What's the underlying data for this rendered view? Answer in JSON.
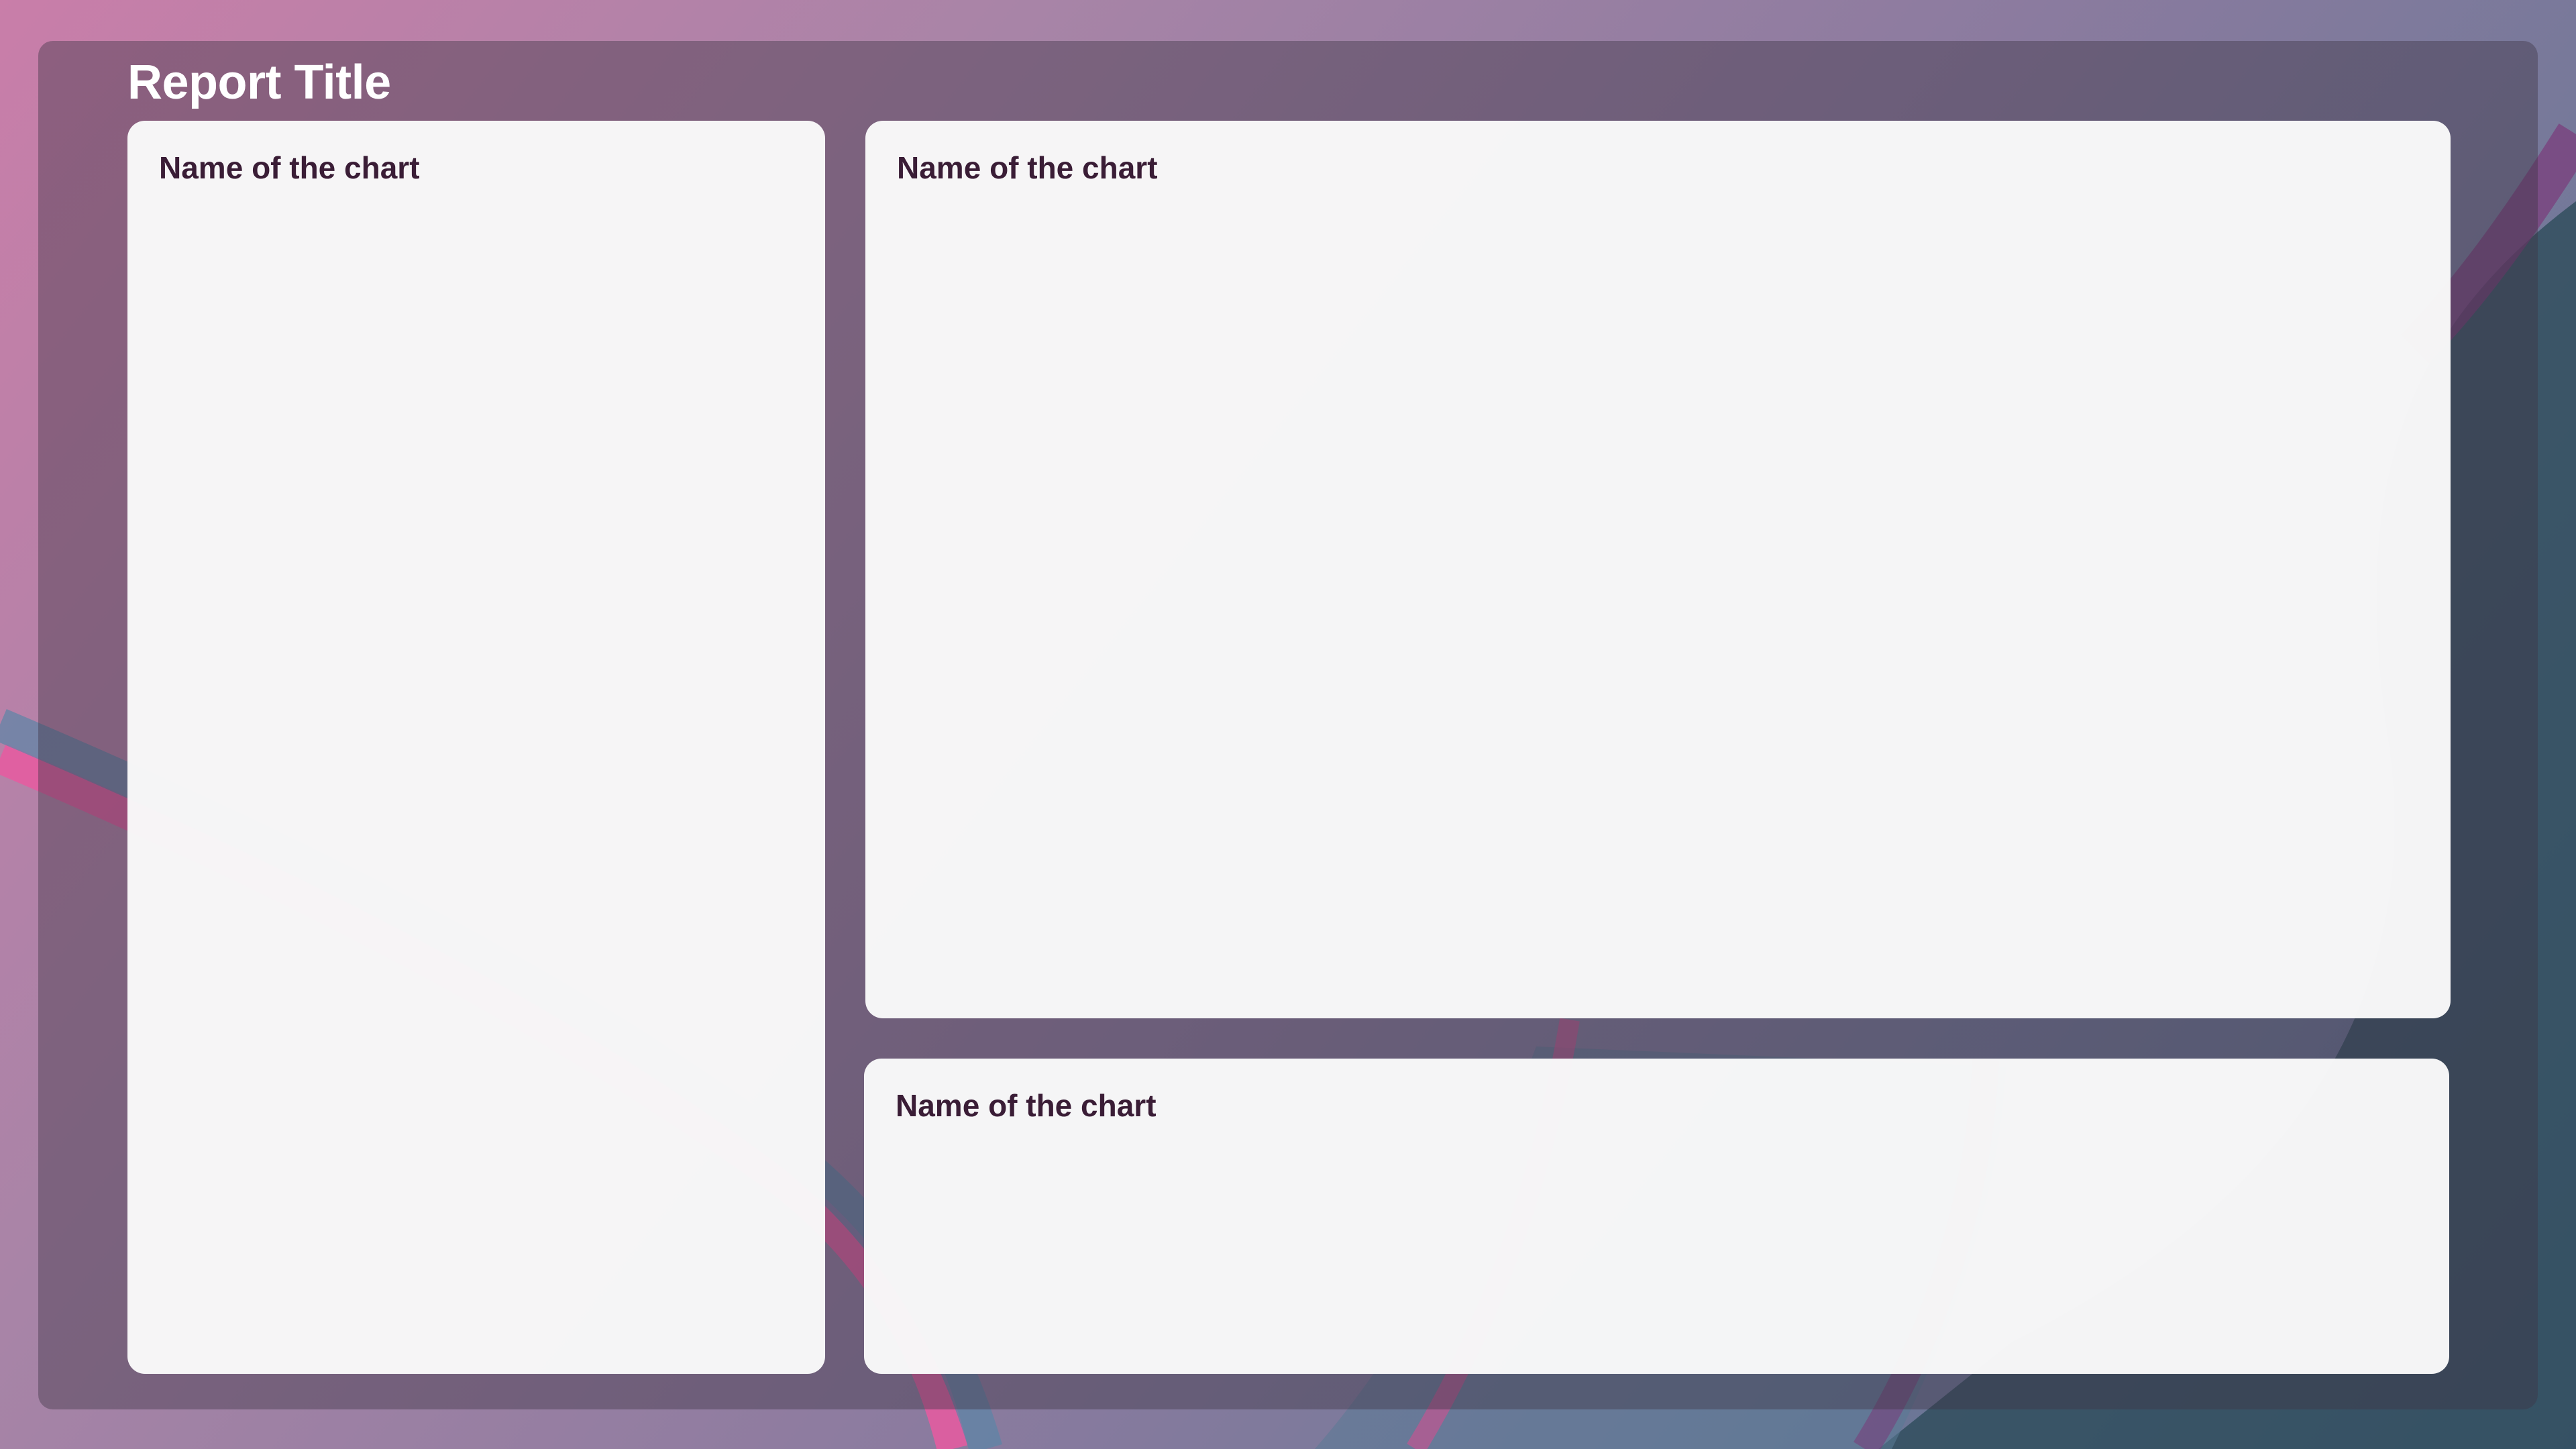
{
  "report": {
    "title": "Report Title"
  },
  "cards": {
    "left": {
      "title": "Name of the chart"
    },
    "top": {
      "title": "Name of the chart"
    },
    "bottom": {
      "title": "Name of the chart"
    }
  },
  "colors": {
    "background_start": "#c97ea9",
    "background_end": "#5a6a8a",
    "panel_overlay": "#3e3444",
    "card_background": "#fafafa",
    "card_title": "#3a1d36",
    "report_title": "#ffffff",
    "accent_pink": "#e85aa0",
    "accent_blue": "#5b86a6",
    "accent_purple": "#6a3a6a"
  }
}
